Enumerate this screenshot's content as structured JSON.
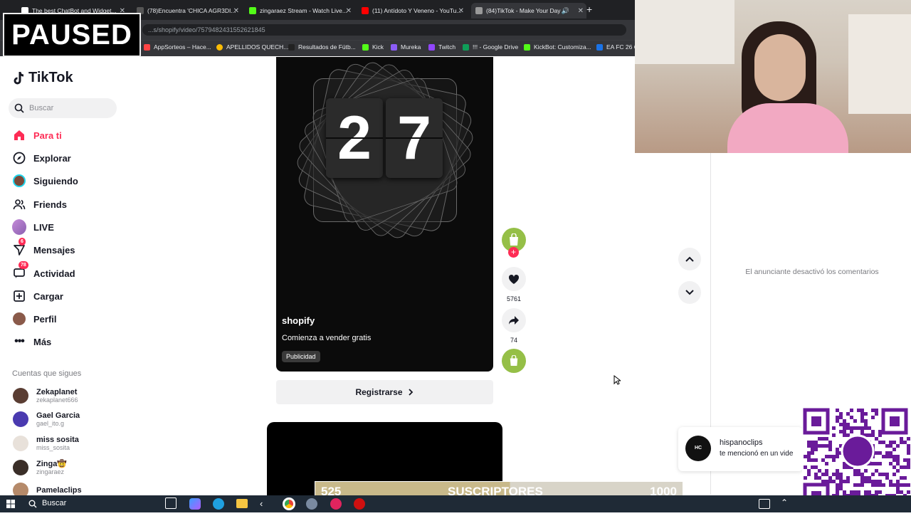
{
  "browser": {
    "tabs": [
      {
        "label": "The best ChatBot and Widget...",
        "color": "#ffffff"
      },
      {
        "label": "(78)Encuentra 'CHICA AGR3DI...",
        "color": "#161823"
      },
      {
        "label": "zingaraez Stream - Watch Live...",
        "color": "#53fc18"
      },
      {
        "label": "(11) Antídoto Y Veneno - YouTu...",
        "color": "#ff0000"
      },
      {
        "label": "(84)TikTok - Make Your Day",
        "color": "#161823"
      }
    ],
    "url": "...s/shopify/video/7579482431552621845",
    "bookmarks": [
      "AppSorteos – Hace...",
      "APELLIDOS QUECH...",
      "Resultados de Fútb...",
      "Kick",
      "Mureka",
      "Twitch",
      "!!! - Google Drive",
      "KickBot: Customiza...",
      "EA FC 26 C"
    ]
  },
  "overlay": {
    "paused": "PAUSED"
  },
  "sidebar": {
    "logo": "TikTok",
    "search_placeholder": "Buscar",
    "nav": [
      {
        "label": "Para ti",
        "icon": "home-icon",
        "active": true
      },
      {
        "label": "Explorar",
        "icon": "compass-icon"
      },
      {
        "label": "Siguiendo",
        "icon": "following-avatar-icon"
      },
      {
        "label": "Friends",
        "icon": "friends-icon"
      },
      {
        "label": "LIVE",
        "icon": "live-avatar-icon"
      },
      {
        "label": "Mensajes",
        "icon": "messages-icon",
        "badge": "6"
      },
      {
        "label": "Actividad",
        "icon": "activity-icon",
        "badge": "78"
      },
      {
        "label": "Cargar",
        "icon": "upload-icon"
      },
      {
        "label": "Perfil",
        "icon": "profile-avatar-icon"
      },
      {
        "label": "Más",
        "icon": "more-icon"
      }
    ],
    "following_title": "Cuentas que sigues",
    "following": [
      {
        "name": "Zekaplanet",
        "handle": "zekaplanet666"
      },
      {
        "name": "Gael Garcia",
        "handle": "gael_ito.g"
      },
      {
        "name": "miss sosita",
        "handle": "miss_sosita"
      },
      {
        "name": "Zinga🤠",
        "handle": "zingaraez"
      },
      {
        "name": "Pamelaclips",
        "handle": ""
      }
    ]
  },
  "video": {
    "digits": [
      "2",
      "7"
    ],
    "author": "shopify",
    "description": "Comienza a vender gratis",
    "tag": "Publicidad",
    "register_label": "Registrarse"
  },
  "actions": {
    "likes": "5761",
    "shares": "74"
  },
  "comments": {
    "disabled_text": "El anunciante desactivó los comentarios"
  },
  "notification": {
    "name": "hispanoclips",
    "text": "te mencionó en un vide"
  },
  "subs": {
    "current": "525",
    "label": "SUSCRIPTORES",
    "goal": "1000",
    "progress": 0.525
  },
  "taskbar": {
    "search": "Buscar"
  },
  "colors": {
    "accent": "#fe2c55",
    "shopify": "#95bf47"
  }
}
